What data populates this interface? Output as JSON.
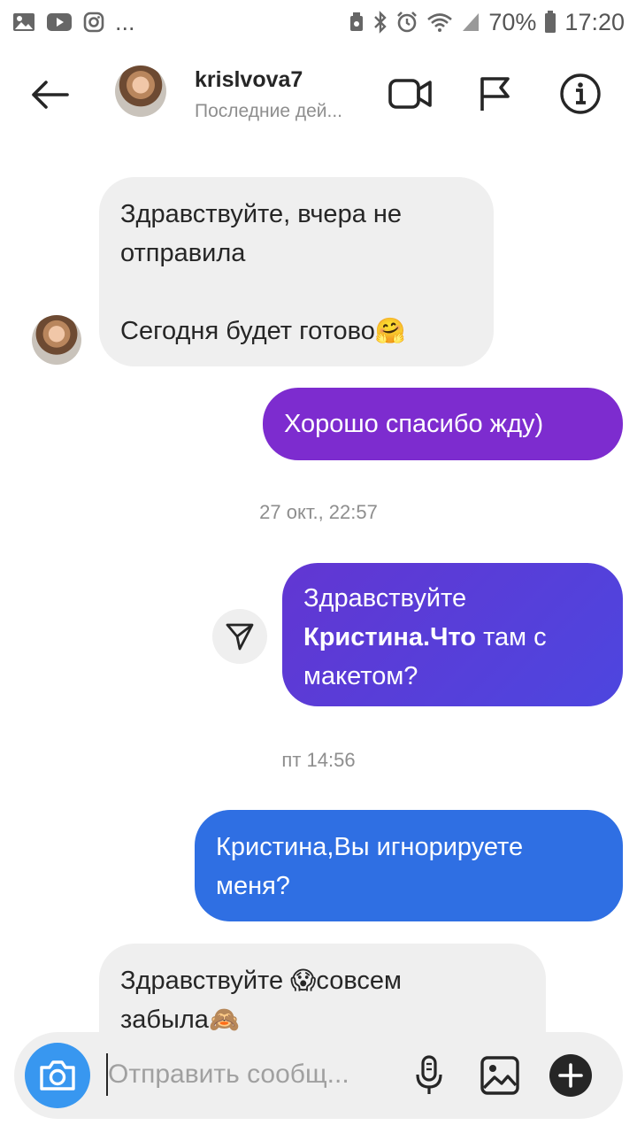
{
  "status_bar": {
    "dots": "...",
    "battery": "70%",
    "time": "17:20"
  },
  "header": {
    "username": "krislvova7",
    "last_active": "Последние дей..."
  },
  "messages": [
    {
      "direction": "incoming",
      "lines": [
        "Здравствуйте, вчера не",
        "отправила",
        "",
        "Сегодня будет готово"
      ],
      "emoji": "🤗"
    },
    {
      "direction": "outgoing",
      "color": "#7d2ccf",
      "text": "Хорошо спасибо жду)"
    },
    {
      "direction": "outgoing",
      "color": "#5a3ad8",
      "line1": "Здравствуйте",
      "bold": "Кристина.Что",
      "after_bold": " там с",
      "line3": "макетом?"
    },
    {
      "direction": "outgoing",
      "color": "#2f6fe3",
      "lines": [
        "Кристина,Вы игнорируете",
        "меня?"
      ]
    },
    {
      "direction": "incoming",
      "line1_before": "Здравствуйте ",
      "emoji1": "😱",
      "line1_after": "совсем",
      "line2": "забыла",
      "emoji2": "🙈"
    }
  ],
  "timestamps": [
    "27 окт., 22:57",
    "пт 14:56"
  ],
  "composer": {
    "placeholder": "Отправить сообщ..."
  },
  "icons": {
    "status": [
      "gallery-icon",
      "youtube-icon",
      "instagram-icon",
      "nfc-icon",
      "bluetooth-icon",
      "alarm-icon",
      "wifi-icon",
      "signal-icon",
      "battery-icon"
    ],
    "header": [
      "back-arrow-icon",
      "video-call-icon",
      "flag-icon",
      "info-icon"
    ],
    "composer": [
      "camera-icon",
      "microphone-icon",
      "image-icon",
      "plus-icon"
    ]
  },
  "colors": {
    "accent_blue": "#3897f0",
    "bubble_purple": "#7d2ccf",
    "bubble_indigo": "#5a3ad8",
    "bubble_blue": "#2f6fe3",
    "bubble_gray": "#efefef"
  }
}
